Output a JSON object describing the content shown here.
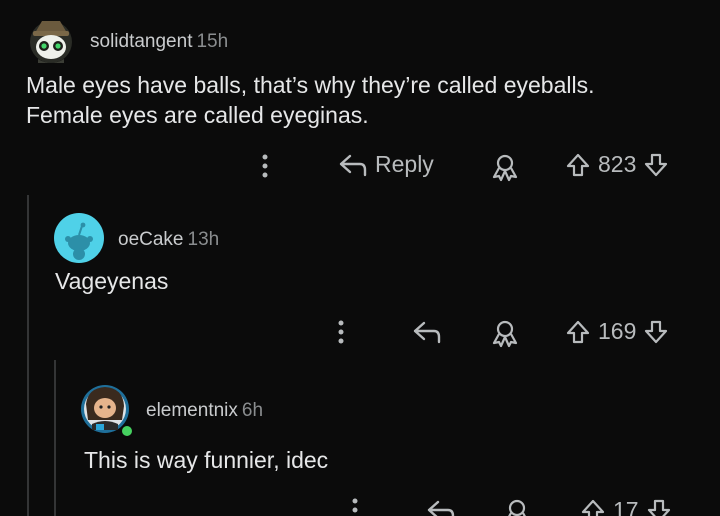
{
  "comments": [
    {
      "username": "solidtangent",
      "age": "15h",
      "body_lines": [
        "Male eyes have balls, that’s why they’re called eyeballs.",
        "Female eyes are called eyeginas."
      ],
      "reply_label": "Reply",
      "score": "823",
      "avatar_icon": "snoo-avatar-hat-icon"
    },
    {
      "username": "oeCake",
      "age": "13h",
      "body_lines": [
        "Vageyenas"
      ],
      "score": "169",
      "avatar_icon": "default-snoo-avatar-icon",
      "avatar_color": "#4fd1e8"
    },
    {
      "username": "elementnix",
      "age": "6h",
      "body_lines": [
        "This is way funnier, idec"
      ],
      "score": "17",
      "avatar_icon": "custom-avatar-icon",
      "online_color": "#46d160"
    }
  ]
}
